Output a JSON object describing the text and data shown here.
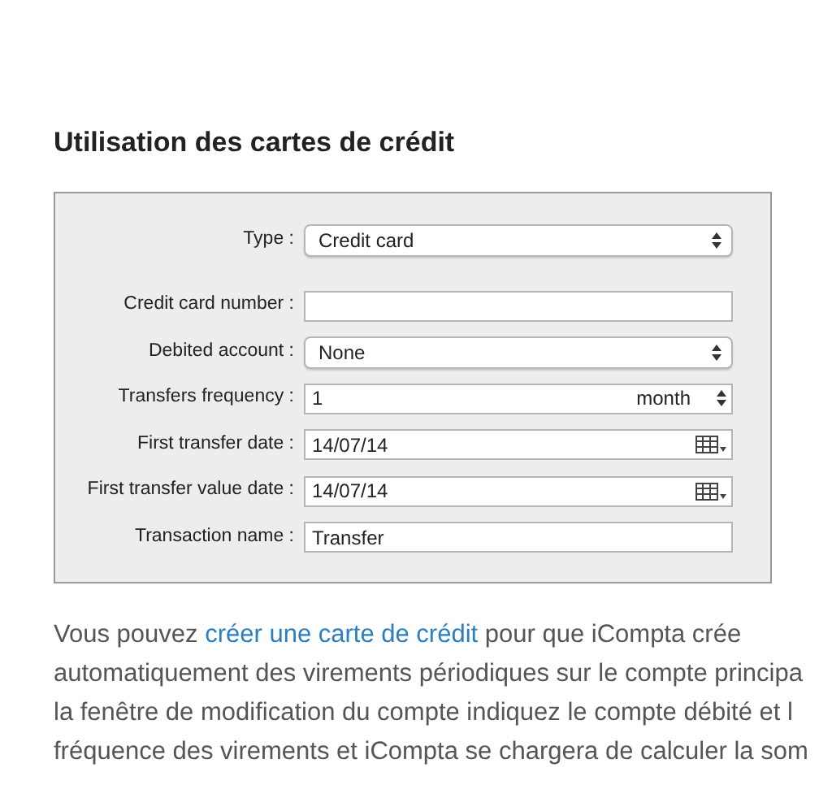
{
  "heading": "Utilisation des cartes de crédit",
  "form": {
    "rows": [
      {
        "kind": "popup",
        "label": "Type :",
        "value": "Credit card"
      },
      {
        "kind": "text",
        "label": "Credit card number :",
        "value": ""
      },
      {
        "kind": "popup",
        "label": "Debited account :",
        "value": "None"
      },
      {
        "kind": "stepper",
        "label": "Transfers frequency :",
        "value": "1",
        "unit": "month"
      },
      {
        "kind": "date",
        "label": "First transfer date :",
        "value": "14/07/14"
      },
      {
        "kind": "date",
        "label": "First transfer value date :",
        "value": "14/07/14"
      },
      {
        "kind": "text",
        "label": "Transaction name :",
        "value": "Transfer"
      }
    ]
  },
  "paragraph": {
    "first_line": {
      "before": "Vous pouvez ",
      "link": "créer une carte de crédit",
      "after": " pour que iCompta crée"
    },
    "lines": [
      "automatiquement des virements périodiques sur le compte principa",
      "la fenêtre de modification du compte indiquez le compte débité et l",
      "fréquence des virements et iCompta se chargera de calculer la som"
    ]
  }
}
